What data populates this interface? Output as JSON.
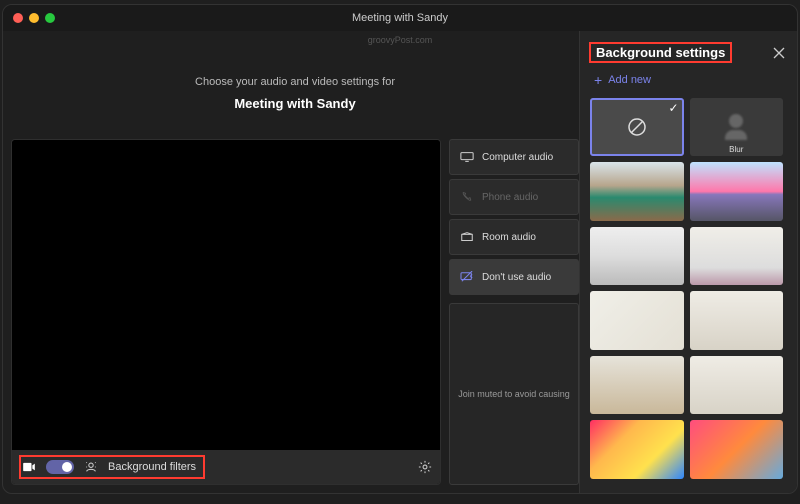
{
  "window": {
    "title": "Meeting with Sandy"
  },
  "watermark": "groovyPost.com",
  "prompt": "Choose your audio and video settings for",
  "meeting_title": "Meeting with Sandy",
  "preview_bar": {
    "background_filters_label": "Background filters"
  },
  "audio_options": {
    "computer": "Computer audio",
    "phone": "Phone audio",
    "room": "Room audio",
    "none": "Don't use audio"
  },
  "join_muted": "Join muted to avoid causing",
  "panel": {
    "title": "Background settings",
    "add_new": "Add new",
    "blur_label": "Blur",
    "backgrounds": [
      {
        "id": "none",
        "selected": true
      },
      {
        "id": "blur"
      },
      {
        "id": "img1"
      },
      {
        "id": "img2"
      },
      {
        "id": "img3"
      },
      {
        "id": "img4"
      },
      {
        "id": "img5"
      },
      {
        "id": "img6"
      },
      {
        "id": "img7"
      },
      {
        "id": "img6"
      },
      {
        "id": "img8"
      },
      {
        "id": "img9"
      }
    ]
  },
  "highlight": {
    "color": "#ff3b30",
    "targets": [
      "background-filters-group",
      "panel-title"
    ]
  }
}
